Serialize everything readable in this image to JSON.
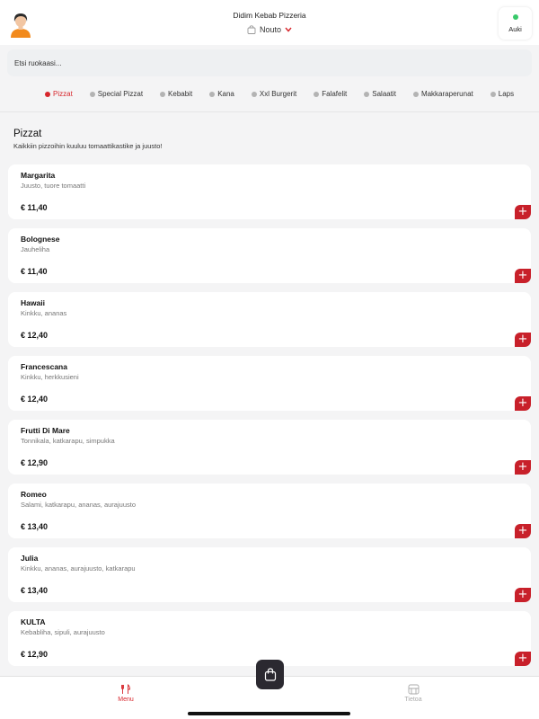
{
  "header": {
    "shop_name": "Didim Kebab Pizzeria",
    "pickup_label": "Nouto",
    "status_label": "Auki",
    "status_color": "#38c96a"
  },
  "search": {
    "placeholder": "Etsi ruokaasi..."
  },
  "categories": [
    "Pizzat",
    "Special Pizzat",
    "Kebabit",
    "Kana",
    "Xxl Burgerit",
    "Falafelit",
    "Salaatit",
    "Makkaraperunat",
    "Laps"
  ],
  "active_category": "Pizzat",
  "section": {
    "title": "Pizzat",
    "subtitle": "Kaikkiin pizzoihin kuuluu tomaattikastike ja juusto!"
  },
  "items": [
    {
      "name": "Margarita",
      "desc": "Juusto, tuore tomaatti",
      "price": "€ 11,40"
    },
    {
      "name": "Bolognese",
      "desc": "Jauheliha",
      "price": "€ 11,40"
    },
    {
      "name": "Hawaii",
      "desc": "Kinkku, ananas",
      "price": "€ 12,40"
    },
    {
      "name": "Francescana",
      "desc": "Kinkku, herkkusieni",
      "price": "€ 12,40"
    },
    {
      "name": "Frutti Di Mare",
      "desc": "Tonnikala, katkarapu, simpukka",
      "price": "€ 12,90"
    },
    {
      "name": "Romeo",
      "desc": "Salami, katkarapu, ananas, aurajuusto",
      "price": "€ 13,40"
    },
    {
      "name": "Julia",
      "desc": "Kinkku, ananas, aurajuusto, katkarapu",
      "price": "€ 13,40"
    },
    {
      "name": "KULTA",
      "desc": "Kebabliha, sipuli, aurajuusto",
      "price": "€ 12,90"
    }
  ],
  "add_label": "+",
  "tabs": {
    "menu": "Menu",
    "info": "Tietoa"
  },
  "colors": {
    "accent": "#d7262c",
    "add_button": "#c8202a",
    "cart_button": "#2b2930"
  }
}
